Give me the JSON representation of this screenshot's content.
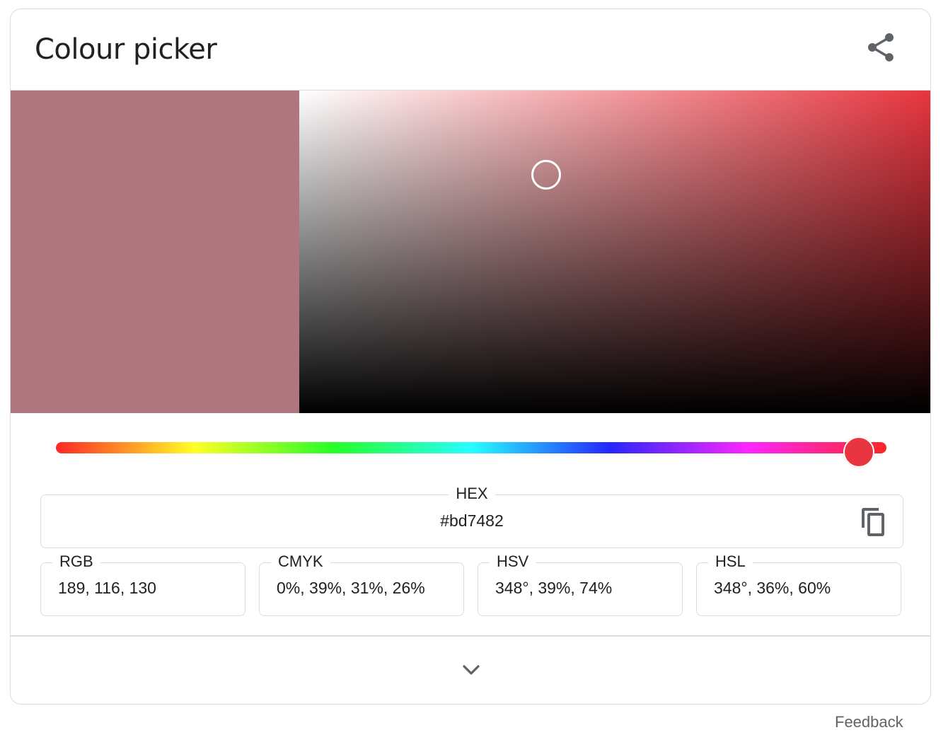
{
  "widget": {
    "title": "Colour picker",
    "share_icon": "share-icon",
    "copy_icon": "copy-icon",
    "expand_icon": "chevron-down-icon"
  },
  "color": {
    "selected_hex": "#b07680",
    "hue_hex": "#e8353f",
    "hue_degrees": 348,
    "saturation_fraction": 0.39,
    "value_fraction": 0.74
  },
  "fields": {
    "hex": {
      "label": "HEX",
      "value": "#bd7482"
    },
    "rgb": {
      "label": "RGB",
      "value": "189, 116, 130"
    },
    "cmyk": {
      "label": "CMYK",
      "value": "0%, 39%, 31%, 26%"
    },
    "hsv": {
      "label": "HSV",
      "value": "348°, 39%, 74%"
    },
    "hsl": {
      "label": "HSL",
      "value": "348°, 36%, 60%"
    }
  },
  "footer": {
    "feedback_label": "Feedback"
  }
}
